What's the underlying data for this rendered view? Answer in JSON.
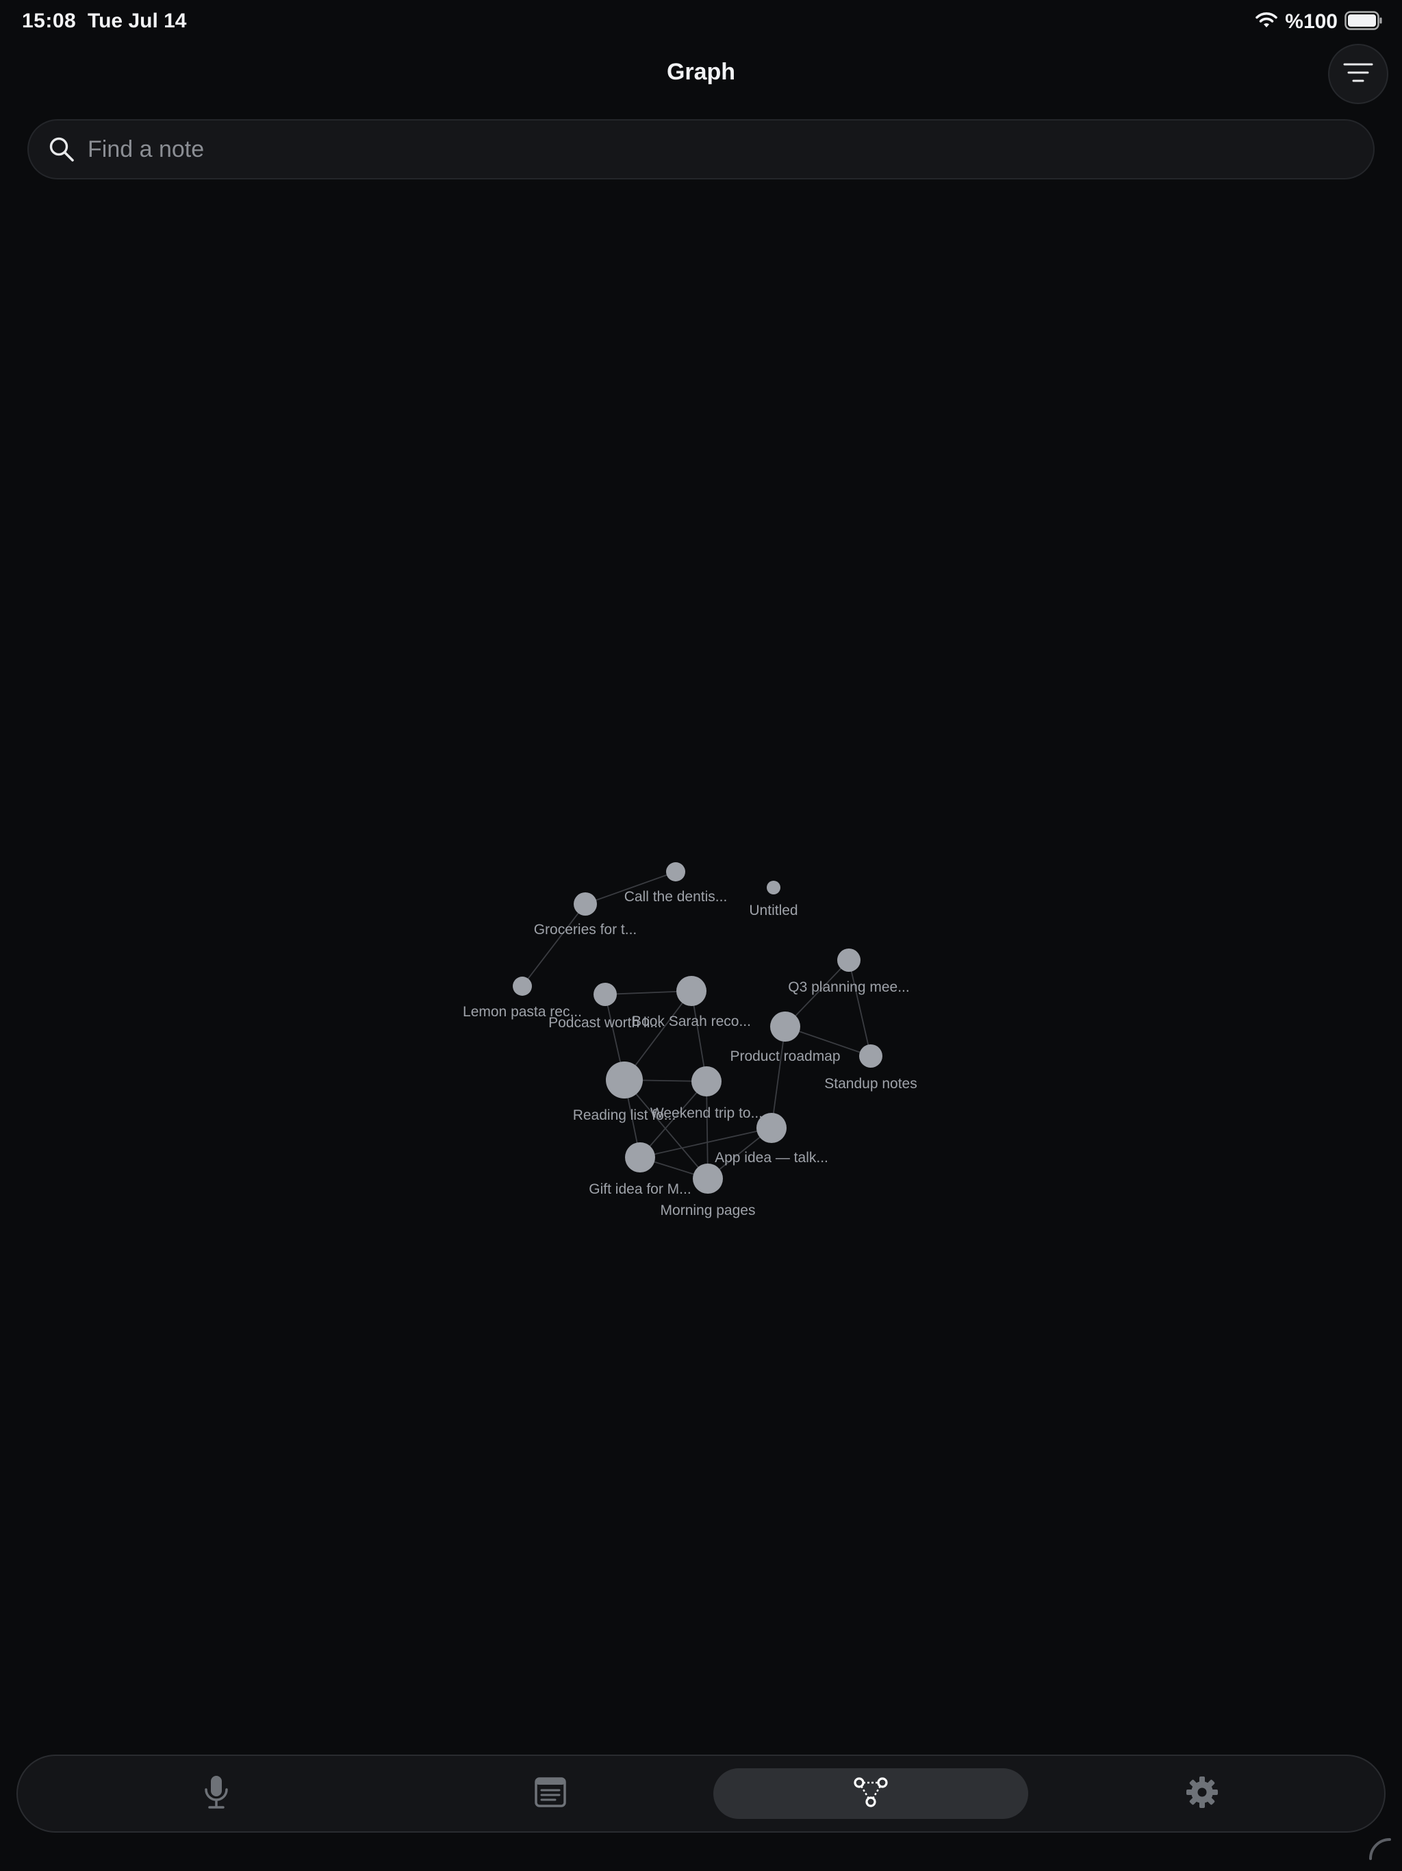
{
  "status_bar": {
    "time": "15:08",
    "date": "Tue Jul 14",
    "battery_text": "%100"
  },
  "header": {
    "title": "Graph"
  },
  "search": {
    "placeholder": "Find a note",
    "value": ""
  },
  "graph": {
    "nodes": [
      {
        "id": "call-dentist",
        "label": "Call the dentis...",
        "size": "small"
      },
      {
        "id": "groceries",
        "label": "Groceries for t...",
        "size": "medium"
      },
      {
        "id": "untitled",
        "label": "Untitled",
        "size": "tiny"
      },
      {
        "id": "lemon-pasta",
        "label": "Lemon pasta rec...",
        "size": "small"
      },
      {
        "id": "podcast",
        "label": "Podcast worth li...",
        "size": "medium"
      },
      {
        "id": "book-sarah",
        "label": "Book Sarah reco...",
        "size": "large"
      },
      {
        "id": "q3-planning",
        "label": "Q3 planning mee...",
        "size": "medium"
      },
      {
        "id": "product-roadmap",
        "label": "Product roadmap",
        "size": "large"
      },
      {
        "id": "standup",
        "label": "Standup notes",
        "size": "medium"
      },
      {
        "id": "reading-list",
        "label": "Reading list fo...",
        "size": "xlarge"
      },
      {
        "id": "weekend-trip",
        "label": "Weekend trip to...",
        "size": "large"
      },
      {
        "id": "app-idea",
        "label": "App idea — talk...",
        "size": "large"
      },
      {
        "id": "gift-idea",
        "label": "Gift idea for M...",
        "size": "large"
      },
      {
        "id": "morning-pages",
        "label": "Morning pages",
        "size": "large"
      }
    ],
    "edges": [
      [
        "call-dentist",
        "groceries"
      ],
      [
        "groceries",
        "lemon-pasta"
      ],
      [
        "podcast",
        "book-sarah"
      ],
      [
        "podcast",
        "reading-list"
      ],
      [
        "book-sarah",
        "reading-list"
      ],
      [
        "book-sarah",
        "weekend-trip"
      ],
      [
        "reading-list",
        "weekend-trip"
      ],
      [
        "reading-list",
        "gift-idea"
      ],
      [
        "reading-list",
        "morning-pages"
      ],
      [
        "weekend-trip",
        "gift-idea"
      ],
      [
        "weekend-trip",
        "morning-pages"
      ],
      [
        "gift-idea",
        "morning-pages"
      ],
      [
        "gift-idea",
        "app-idea"
      ],
      [
        "morning-pages",
        "app-idea"
      ],
      [
        "app-idea",
        "product-roadmap"
      ],
      [
        "product-roadmap",
        "q3-planning"
      ],
      [
        "product-roadmap",
        "standup"
      ],
      [
        "q3-planning",
        "standup"
      ]
    ]
  },
  "tab_bar": {
    "tabs": [
      {
        "name": "record",
        "icon": "microphone-icon",
        "active": false
      },
      {
        "name": "notes",
        "icon": "notes-list-icon",
        "active": false
      },
      {
        "name": "graph",
        "icon": "graph-icon",
        "active": true
      },
      {
        "name": "settings",
        "icon": "gear-icon",
        "active": false
      }
    ]
  },
  "colors": {
    "background": "#0a0b0d",
    "node_fill": "#9ea2a9",
    "edge": "#3a3c41",
    "label": "#9ea2a9",
    "active_tab": "#2e3034"
  }
}
